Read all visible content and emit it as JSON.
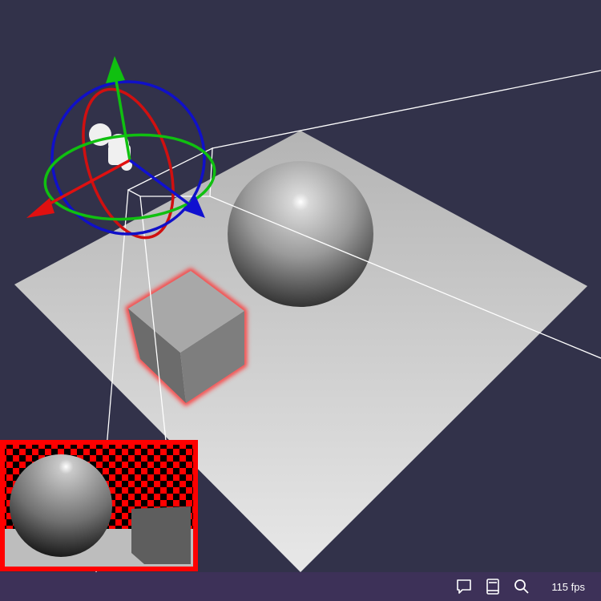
{
  "statusbar": {
    "icons": [
      "chat-icon",
      "book-icon",
      "search-icon"
    ],
    "fps_label": "115 fps"
  },
  "colors": {
    "background": "#32324a",
    "statusbar": "#3d3158",
    "selection_outline": "#ff2020",
    "axis_x": "#e01010",
    "axis_y": "#10c010",
    "axis_z": "#1010d0"
  }
}
